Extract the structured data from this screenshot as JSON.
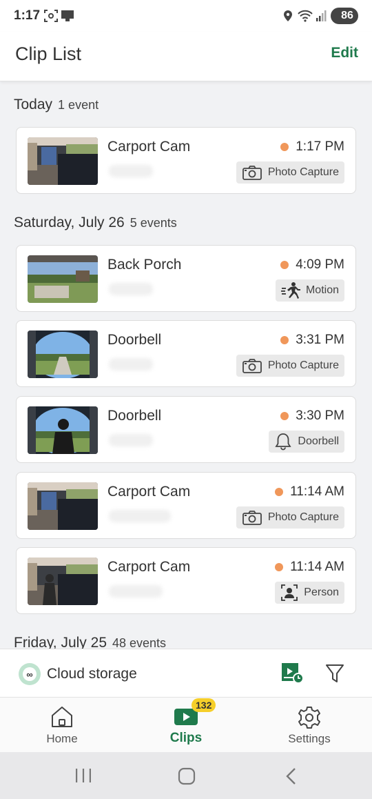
{
  "status_bar": {
    "time": "1:17",
    "battery": "86"
  },
  "header": {
    "title": "Clip List",
    "edit_label": "Edit"
  },
  "groups": [
    {
      "title": "Today",
      "count": "1 event",
      "clips": [
        {
          "camera": "Carport Cam",
          "time": "1:17 PM",
          "tag": "Photo Capture",
          "tag_icon": "camera-icon",
          "thumb": "carport"
        }
      ]
    },
    {
      "title": "Saturday, July 26",
      "count": "5 events",
      "clips": [
        {
          "camera": "Back Porch",
          "time": "4:09 PM",
          "tag": "Motion",
          "tag_icon": "motion-icon",
          "thumb": "yard"
        },
        {
          "camera": "Doorbell",
          "time": "3:31 PM",
          "tag": "Photo Capture",
          "tag_icon": "camera-icon",
          "thumb": "door"
        },
        {
          "camera": "Doorbell",
          "time": "3:30 PM",
          "tag": "Doorbell",
          "tag_icon": "bell-icon",
          "thumb": "door-person"
        },
        {
          "camera": "Carport Cam",
          "time": "11:14 AM",
          "tag": "Photo Capture",
          "tag_icon": "camera-icon",
          "thumb": "carport"
        },
        {
          "camera": "Carport Cam",
          "time": "11:14 AM",
          "tag": "Person",
          "tag_icon": "person-icon",
          "thumb": "carport-person"
        }
      ]
    },
    {
      "title": "Friday, July 25",
      "count": "48 events"
    }
  ],
  "cloud_bar": {
    "label": "Cloud storage"
  },
  "tabs": [
    {
      "label": "Home",
      "icon": "home-icon"
    },
    {
      "label": "Clips",
      "icon": "clips-icon",
      "badge": "132",
      "active": true
    },
    {
      "label": "Settings",
      "icon": "gear-icon"
    }
  ],
  "colors": {
    "accent": "#1f7a4c",
    "event_dot": "#f0975a",
    "badge": "#f6cf2a"
  }
}
